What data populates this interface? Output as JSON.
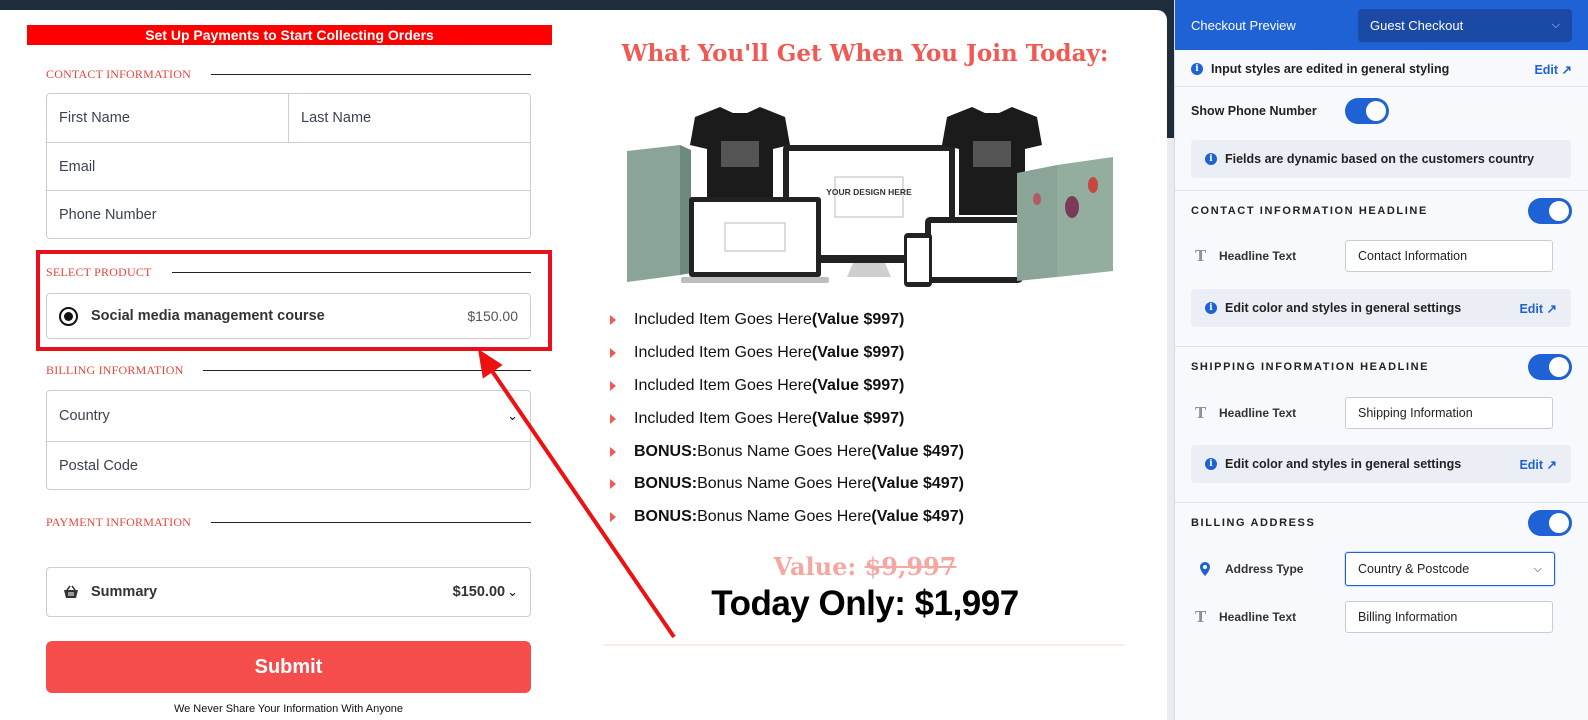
{
  "form": {
    "banner": "Set Up Payments to Start Collecting Orders",
    "contact_heading": "CONTACT INFORMATION",
    "first_name_placeholder": "First Name",
    "last_name_placeholder": "Last Name",
    "email_placeholder": "Email",
    "phone_placeholder": "Phone Number",
    "select_product_heading": "SELECT PRODUCT",
    "product_name": "Social media management course",
    "product_price": "$150.00",
    "billing_heading": "BILLING INFORMATION",
    "country_placeholder": "Country",
    "postal_placeholder": "Postal Code",
    "payment_heading": "PAYMENT INFORMATION",
    "summary_label": "Summary",
    "summary_price": "$150.00",
    "submit_label": "Submit",
    "privacy_note": "We Never Share Your Information With Anyone"
  },
  "promo": {
    "title": "What You'll Get When You Join Today:",
    "mockup_text": "YOUR DESIGN HERE",
    "bullets": [
      {
        "prefix": "",
        "text": "Included Item Goes Here ",
        "value": "(Value $997)"
      },
      {
        "prefix": "",
        "text": "Included Item Goes Here ",
        "value": "(Value $997)"
      },
      {
        "prefix": "",
        "text": "Included Item Goes Here ",
        "value": "(Value $997)"
      },
      {
        "prefix": "",
        "text": "Included Item Goes Here ",
        "value": "(Value $997)"
      },
      {
        "prefix": "BONUS:",
        "text": " Bonus Name Goes Here ",
        "value": "(Value $497)"
      },
      {
        "prefix": "BONUS:",
        "text": " Bonus Name Goes Here ",
        "value": "(Value $497)"
      },
      {
        "prefix": "BONUS:",
        "text": " Bonus Name Goes Here ",
        "value": "(Value $497)"
      }
    ],
    "value_label": "Value: ",
    "value_amount": "$9,997",
    "today_only": "Today Only: $1,997"
  },
  "panel": {
    "header_title": "Checkout Preview",
    "mode": "Guest Checkout",
    "input_styles_note": "Input styles are edited in general styling",
    "edit_label": "Edit",
    "show_phone_label": "Show Phone Number",
    "show_phone_enabled": true,
    "dynamic_fields_note": "Fields are dynamic based on the customers country",
    "contact_section": "CONTACT INFORMATION HEADLINE",
    "contact_enabled": true,
    "headline_text_label": "Headline Text",
    "contact_headline_value": "Contact Information",
    "color_styles_note": "Edit color and styles in general settings",
    "shipping_section": "SHIPPING INFORMATION HEADLINE",
    "shipping_enabled": true,
    "shipping_headline_value": "Shipping Information",
    "billing_section": "BILLING ADDRESS",
    "billing_enabled": true,
    "address_type_label": "Address Type",
    "address_type_value": "Country & Postcode",
    "billing_headline_value": "Billing Information"
  },
  "colors": {
    "accent": "#1e62d6",
    "brand_red": "#f44d4b",
    "highlight_red": "#e8101a"
  }
}
